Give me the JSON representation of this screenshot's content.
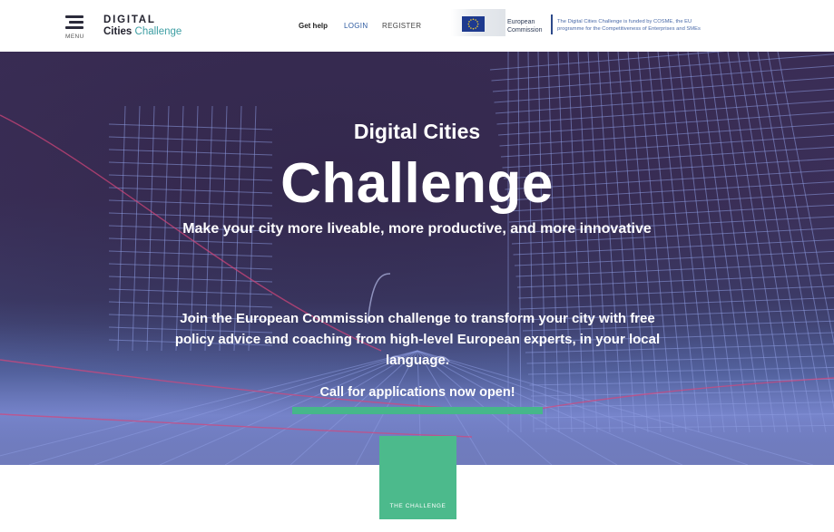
{
  "header": {
    "menu_label": "MENU",
    "logo": {
      "line1": "DIGITAL",
      "line2_dark": "Cities",
      "line2_accent": "Challenge"
    },
    "nav": {
      "help": "Get help",
      "login": "LOGIN",
      "register": "REGISTER"
    },
    "ec_logo": {
      "line1": "European",
      "line2": "Commission"
    },
    "funding_note_line1": "The Digital Cities Challenge is funded by COSME, the EU",
    "funding_note_line2": "programme for the Competitiveness of Enterprises and SMEs"
  },
  "hero": {
    "subtitle": "Digital Cities",
    "title": "Challenge",
    "tagline": "Make your city more liveable, more productive, and more innovative",
    "description": "Join the European Commission challenge to transform your city with free policy advice and coaching from high-level European experts, in your local language.",
    "cta": "Call for applications now open!"
  },
  "challenge_tile": {
    "label": "THE CHALLENGE"
  },
  "colors": {
    "accent_green": "#46b78a",
    "logo_teal": "#3d9ea3",
    "link_blue": "#2d5aa0",
    "eu_blue": "#1e3a8f",
    "hero_purple": "#3a2d55"
  },
  "icons": [
    "hamburger-menu-icon",
    "eu-flag-icon"
  ]
}
